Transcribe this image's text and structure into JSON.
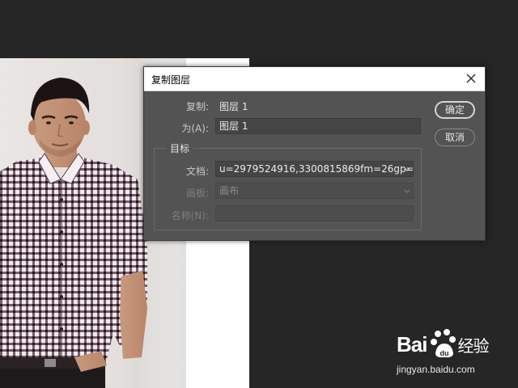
{
  "dialog": {
    "title": "复制图层",
    "copy_label": "复制:",
    "copy_value": "图层 1",
    "as_label": "为(A):",
    "as_value": "图层 1",
    "ok_button": "确定",
    "cancel_button": "取消",
    "target_group": {
      "legend": "目标",
      "document_label": "文档:",
      "document_value": "u=2979524916,3300815869fm=26gp=...",
      "artboard_label": "画板:",
      "artboard_value": "画布",
      "name_label": "名称(N):",
      "name_value": ""
    }
  },
  "watermark": {
    "logo_left": "Bai",
    "logo_right": "经验",
    "url": "jingyan.baidu.com"
  },
  "colors": {
    "workspace_bg": "#262626",
    "dialog_bg": "#535353",
    "field_bg": "#454545"
  }
}
